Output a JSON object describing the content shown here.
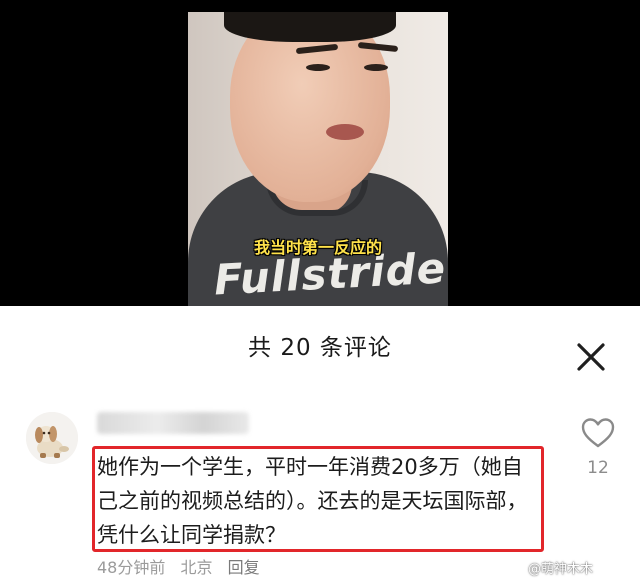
{
  "video": {
    "subtitle": "我当时第一反应的",
    "shirt_text": "Fullstride"
  },
  "sheet": {
    "title": "共 20 条评论",
    "close_icon": "close-icon"
  },
  "comment": {
    "avatar_icon": "plush-toy-avatar",
    "text": "她作为一个学生，平时一年消费20多万（她自己之前的视频总结的）。还去的是天坛国际部，凭什么让同学捐款？",
    "time": "48分钟前",
    "location": "北京",
    "reply_label": "回复",
    "like_icon": "heart-outline-icon",
    "like_count": "12"
  },
  "watermark": "@萌神木木",
  "colors": {
    "highlight": "#e2262a",
    "subtitle": "#ffe24a",
    "meta_text": "#9b9b9b"
  }
}
